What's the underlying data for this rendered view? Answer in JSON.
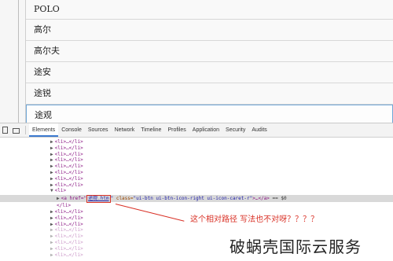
{
  "car_list": {
    "items": [
      "POLO",
      "高尔",
      "高尔夫",
      "途安",
      "途锐",
      "途观"
    ],
    "selected_index": 5
  },
  "devtools": {
    "tabs": [
      "Elements",
      "Console",
      "Sources",
      "Network",
      "Timeline",
      "Profiles",
      "Application",
      "Security",
      "Audits"
    ],
    "active_tab": "Elements",
    "dom_collapsed": "<li>…</li>",
    "dom_open": "<li>",
    "dom_close": "</li>",
    "selected_line": {
      "tag_open": "<a href=\"",
      "href": "途观.htm",
      "quote": "\"",
      "class_label": " class=",
      "class_value": "\"ui-btn ui-btn-icon-right ui-icon-caret-r\"",
      "content_close": ">…</a>",
      "eq": " == $0"
    }
  },
  "annotation": {
    "text": "这个相对路径 写法也不对呀？？？？"
  },
  "watermark": {
    "text": "破蜗壳国际云服务"
  },
  "colors": {
    "accent_red": "#d93025",
    "devtools_active": "#3c79cf",
    "tag_purple": "#881280"
  }
}
